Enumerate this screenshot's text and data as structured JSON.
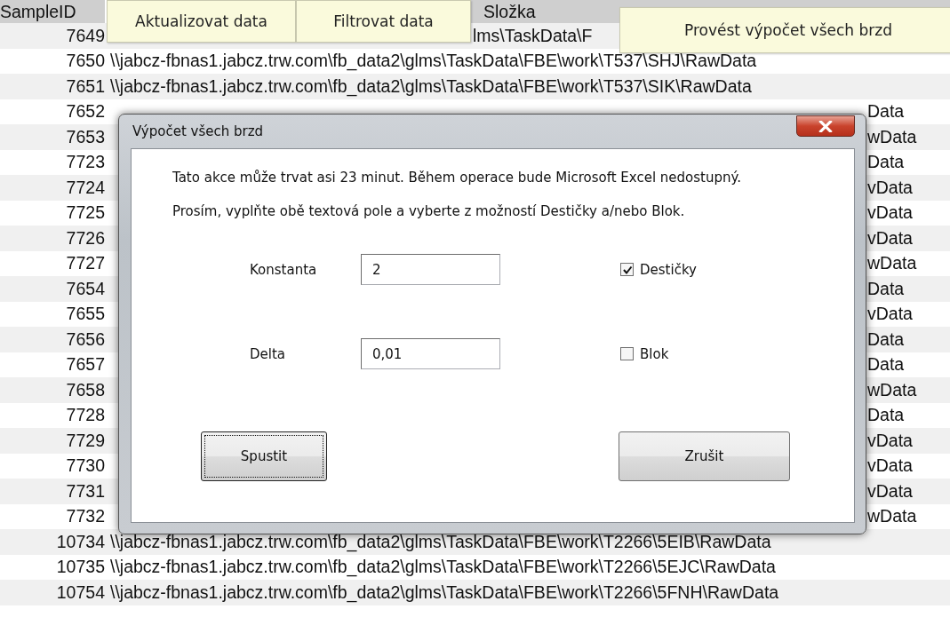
{
  "sheet": {
    "columns": [
      {
        "label": "SampleID"
      },
      {
        "label": "Složka"
      }
    ],
    "rows": [
      {
        "sample_id": "7649",
        "path": "lms\\TaskData\\F",
        "kind": "middle"
      },
      {
        "sample_id": "7650",
        "path": "\\\\jabcz-fbnas1.jabcz.trw.com\\fb_data2\\glms\\TaskData\\FBE\\work\\T537\\SHJ\\RawData",
        "kind": "full"
      },
      {
        "sample_id": "7651",
        "path": "\\\\jabcz-fbnas1.jabcz.trw.com\\fb_data2\\glms\\TaskData\\FBE\\work\\T537\\SIK\\RawData",
        "kind": "full"
      },
      {
        "sample_id": "7652",
        "path": "Data",
        "kind": "end"
      },
      {
        "sample_id": "7653",
        "path": "wData",
        "kind": "end"
      },
      {
        "sample_id": "7723",
        "path": "Data",
        "kind": "end"
      },
      {
        "sample_id": "7724",
        "path": "vData",
        "kind": "end"
      },
      {
        "sample_id": "7725",
        "path": "vData",
        "kind": "end"
      },
      {
        "sample_id": "7726",
        "path": "vData",
        "kind": "end"
      },
      {
        "sample_id": "7727",
        "path": "wData",
        "kind": "end"
      },
      {
        "sample_id": "7654",
        "path": "Data",
        "kind": "end"
      },
      {
        "sample_id": "7655",
        "path": "vData",
        "kind": "end"
      },
      {
        "sample_id": "7656",
        "path": "Data",
        "kind": "end"
      },
      {
        "sample_id": "7657",
        "path": "Data",
        "kind": "end"
      },
      {
        "sample_id": "7658",
        "path": "wData",
        "kind": "end"
      },
      {
        "sample_id": "7728",
        "path": "Data",
        "kind": "end"
      },
      {
        "sample_id": "7729",
        "path": "vData",
        "kind": "end"
      },
      {
        "sample_id": "7730",
        "path": "vData",
        "kind": "end"
      },
      {
        "sample_id": "7731",
        "path": "vData",
        "kind": "end"
      },
      {
        "sample_id": "7732",
        "path": "wData",
        "kind": "end"
      },
      {
        "sample_id": "10734",
        "path": "\\\\jabcz-fbnas1.jabcz.trw.com\\fb_data2\\glms\\TaskData\\FBE\\work\\T2266\\5EIB\\RawData",
        "kind": "full"
      },
      {
        "sample_id": "10735",
        "path": "\\\\jabcz-fbnas1.jabcz.trw.com\\fb_data2\\glms\\TaskData\\FBE\\work\\T2266\\5EJC\\RawData",
        "kind": "full"
      },
      {
        "sample_id": "10754",
        "path": "\\\\jabcz-fbnas1.jabcz.trw.com\\fb_data2\\glms\\TaskData\\FBE\\work\\T2266\\5FNH\\RawData",
        "kind": "full"
      }
    ]
  },
  "sheet_buttons": [
    {
      "label": "Aktualizovat data"
    },
    {
      "label": "Filtrovat data"
    },
    {
      "label": "Provést výpočet všech brzd"
    }
  ],
  "dialog": {
    "title": "Výpočet všech brzd",
    "message": "Tato akce může trvat asi 23 minut. Během operace bude Microsoft Excel nedostupný.",
    "instruction": "Prosím, vyplňte obě textová pole a vyberte z možností Destičky a/nebo Blok.",
    "fields": [
      {
        "label": "Konstanta",
        "value": "2"
      },
      {
        "label": "Delta",
        "value": "0,01"
      }
    ],
    "checkboxes": [
      {
        "label": "Destičky",
        "checked": true
      },
      {
        "label": "Blok",
        "checked": false
      }
    ],
    "buttons": [
      {
        "label": "Spustit",
        "focused": true
      },
      {
        "label": "Zrušit",
        "focused": false
      }
    ]
  }
}
